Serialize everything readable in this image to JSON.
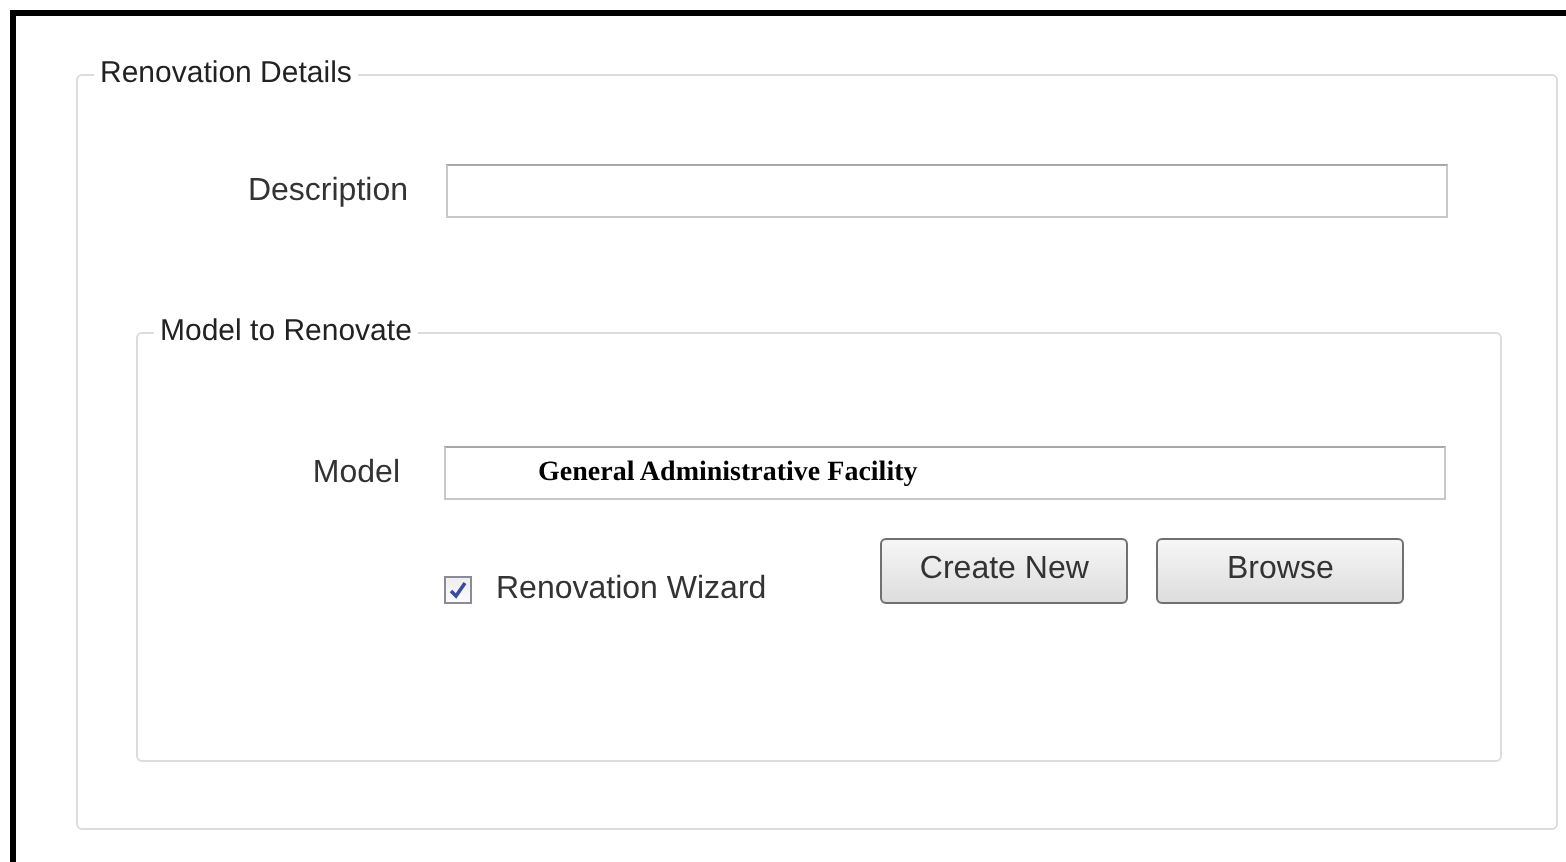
{
  "group": {
    "title": "Renovation Details"
  },
  "description": {
    "label": "Description"
  },
  "model_group": {
    "title": "Model to Renovate"
  },
  "model": {
    "label": "Model",
    "value": "General Administrative Facility"
  },
  "wizard": {
    "label": "Renovation Wizard",
    "checked": true
  },
  "buttons": [
    {
      "label": "Create New"
    },
    {
      "label": "Browse"
    }
  ]
}
